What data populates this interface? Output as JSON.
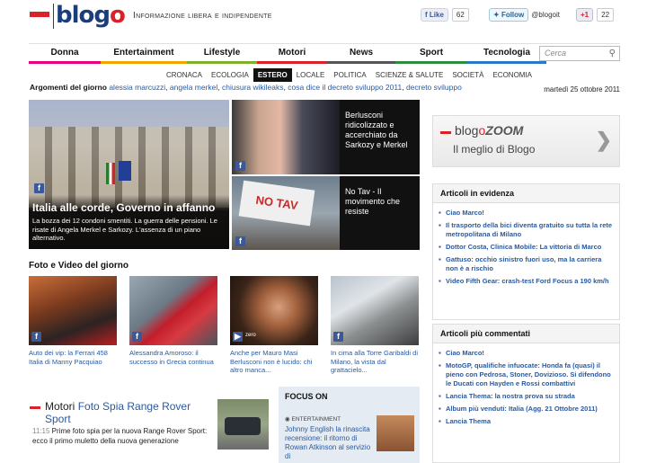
{
  "header": {
    "logo": {
      "prefix": "blog",
      "suffix": "o"
    },
    "tagline": "Informazione libera e indipendente",
    "facebook": {
      "label": "Like",
      "count": "62"
    },
    "twitter": {
      "label": "Follow",
      "handle": "@blogoit"
    },
    "gplus": {
      "label": "+1",
      "count": "22"
    }
  },
  "nav": {
    "items": [
      {
        "label": "Donna",
        "color": "#e5007e"
      },
      {
        "label": "Entertainment",
        "color": "#f0a400"
      },
      {
        "label": "Lifestyle",
        "color": "#7fb02b"
      },
      {
        "label": "Motori",
        "color": "#d9222a"
      },
      {
        "label": "News",
        "color": "#555555"
      },
      {
        "label": "Sport",
        "color": "#2e8d3a"
      },
      {
        "label": "Tecnologia",
        "color": "#2a78c8"
      }
    ],
    "search_placeholder": "Cerca"
  },
  "subnav": [
    "CRONACA",
    "ECOLOGIA",
    "ESTERO",
    "LOCALE",
    "POLITICA",
    "SCIENZE & SALUTE",
    "SOCIETÀ",
    "ECONOMIA"
  ],
  "subnav_active": "ESTERO",
  "topics": {
    "label": "Argomenti del giorno",
    "links": [
      "alessia marcuzzi",
      "angela merkel",
      "chiusura wikileaks",
      "cosa dice il decreto sviluppo 2011",
      "decreto sviluppo"
    ]
  },
  "date": "martedì 25 ottobre 2011",
  "hero": {
    "title": "Italia alle corde, Governo in affanno",
    "text": "La bozza dei 12 condoni smentiti. La guerra delle pensioni. Le risate di Angela Merkel e Sarkozy. L'assenza di un piano alternativo."
  },
  "tiles": [
    {
      "text": "Berlusconi ridicolizzato e accerchiato da Sarkozy e Merkel"
    },
    {
      "text": "No Tav - Il movimento che resiste"
    }
  ],
  "sign_text": "NO TAV",
  "photos": {
    "title": "Foto e Video del giorno",
    "items": [
      {
        "caption": "Auto dei vip: la Ferrari 458 Italia di Manny Pacquiao"
      },
      {
        "caption": "Alessandra Amoroso: il successo in Grecia continua"
      },
      {
        "caption": "Anche per Mauro Masi Berlusconi non è lucido: chi altro manca..."
      },
      {
        "caption": "In cima alla Torre Garibaldi di Milano, la vista dal grattacielo..."
      }
    ],
    "video_label": "zero"
  },
  "motori": {
    "category": "Motori",
    "title": "Foto Spia Range Rover Sport",
    "time": "11:15",
    "text": "Prime foto spia per la nuova Range Rover Sport: ecco il primo muletto della nuova generazione"
  },
  "focus": {
    "title": "FOCUS ON",
    "category": "ENTERTAINMENT",
    "text": "Johnny English la rinascita recensione: il ritorno di Rowan Atkinson al servizio di"
  },
  "zoom": {
    "prefix": "blog",
    "o": "o",
    "word": "ZOOM",
    "subtitle": "Il meglio di Blogo"
  },
  "evidenza": {
    "title": "Articoli in evidenza",
    "items": [
      "Ciao Marco!",
      "Il trasporto della bici diventa gratuito su tutta la rete metropolitana di Milano",
      "Dottor Costa, Clinica Mobile: La vittoria di Marco",
      "Gattuso: occhio sinistro fuori uso, ma la carriera non è a rischio",
      "Video Fifth Gear: crash-test Ford Focus a 190 km/h"
    ]
  },
  "commentati": {
    "title": "Articoli più commentati",
    "items": [
      "Ciao Marco!",
      "MotoGP, qualifiche infuocate: Honda fa (quasi) il pieno con Pedrosa, Stoner, Dovizioso. Si difendono le Ducati con Hayden e Rossi combattivi",
      "Lancia Thema: la nostra prova su strada",
      "Album più venduti: Italia (Agg. 21 Ottobre 2011)",
      "Lancia Thema"
    ]
  }
}
